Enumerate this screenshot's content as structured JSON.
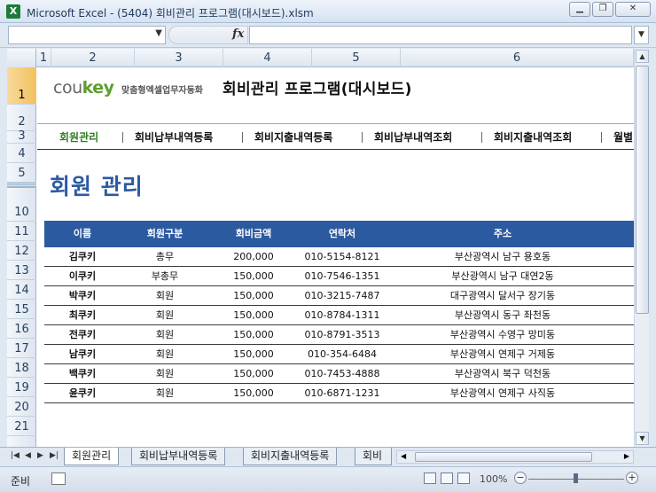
{
  "window": {
    "title": "Microsoft Excel - (5404) 회비관리 프로그램(대시보드).xlsm",
    "app_icon": "X"
  },
  "formula_bar": {
    "fx_label": "fx",
    "name_box": "",
    "formula": ""
  },
  "columns": [
    "1",
    "2",
    "3",
    "4",
    "5",
    "6"
  ],
  "rows": [
    "1",
    "2",
    "3",
    "4",
    "5",
    "10",
    "11",
    "12",
    "13",
    "14",
    "15",
    "16",
    "17",
    "18",
    "19",
    "20",
    "21"
  ],
  "logo": {
    "brand_prefix": "cou",
    "brand_key": "key",
    "tagline": "맞춤형엑셀업무자동화"
  },
  "program_title": "회비관리 프로그램(대시보드)",
  "nav": [
    "회원관리",
    "회비납부내역등록",
    "회비지출내역등록",
    "회비납부내역조회",
    "회비지출내역조회",
    "월별"
  ],
  "page_heading": "회원 관리",
  "table": {
    "headers": [
      "이름",
      "회원구분",
      "회비금액",
      "연락처",
      "주소"
    ],
    "rows": [
      [
        "김쿠키",
        "총무",
        "200,000",
        "010-5154-8121",
        "부산광역시 남구 용호동"
      ],
      [
        "이쿠키",
        "부총무",
        "150,000",
        "010-7546-1351",
        "부산광역시 남구 대연2동"
      ],
      [
        "박쿠키",
        "회원",
        "150,000",
        "010-3215-7487",
        "대구광역시 달서구 장기동"
      ],
      [
        "최쿠키",
        "회원",
        "150,000",
        "010-8784-1311",
        "부산광역시 동구 좌천동"
      ],
      [
        "전쿠키",
        "회원",
        "150,000",
        "010-8791-3513",
        "부산광역시 수영구 망미동"
      ],
      [
        "남쿠키",
        "회원",
        "150,000",
        "010-354-6484",
        "부산광역시 연제구 거제동"
      ],
      [
        "백쿠키",
        "회원",
        "150,000",
        "010-7453-4888",
        "부산광역시 북구 덕천동"
      ],
      [
        "윤쿠키",
        "회원",
        "150,000",
        "010-6871-1231",
        "부산광역시 연제구 사직동"
      ]
    ]
  },
  "sheet_tabs": [
    "회원관리",
    "회비납부내역등록",
    "회비지출내역등록",
    "회비"
  ],
  "status": {
    "ready": "준비",
    "zoom": "100%"
  }
}
